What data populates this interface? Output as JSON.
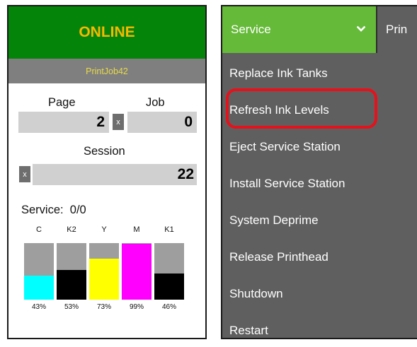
{
  "status": {
    "state": "ONLINE",
    "job_name": "PrintJob42",
    "page_label": "Page",
    "job_label": "Job",
    "page_value": "2",
    "job_value": "0",
    "session_label": "Session",
    "session_value": "22",
    "reset_symbol": "x",
    "service_label": "Service:",
    "service_value": "0/0"
  },
  "inks": [
    {
      "name": "C",
      "level": 43,
      "percent": "43%",
      "color": "#00ffff"
    },
    {
      "name": "K2",
      "level": 53,
      "percent": "53%",
      "color": "#000000"
    },
    {
      "name": "Y",
      "level": 73,
      "percent": "73%",
      "color": "#ffff00"
    },
    {
      "name": "M",
      "level": 99,
      "percent": "99%",
      "color": "#ff00ff"
    },
    {
      "name": "K1",
      "level": 46,
      "percent": "46%",
      "color": "#000000"
    }
  ],
  "colors": {
    "online_bg": "#05840a",
    "online_text": "#f6b900",
    "service_tab_bg": "#66ba3a",
    "menu_bg": "#5f5f5f",
    "highlight_border": "#e8101a"
  },
  "menu": {
    "tab_label": "Service",
    "tab_icon": "chevron-down-icon",
    "next_tab_label": "Prin",
    "items": [
      "Replace Ink Tanks",
      "Refresh Ink Levels",
      "Eject Service Station",
      "Install Service Station",
      "System Deprime",
      "Release Printhead",
      "Shutdown",
      "Restart"
    ],
    "highlighted_item": "Refresh Ink Levels"
  }
}
